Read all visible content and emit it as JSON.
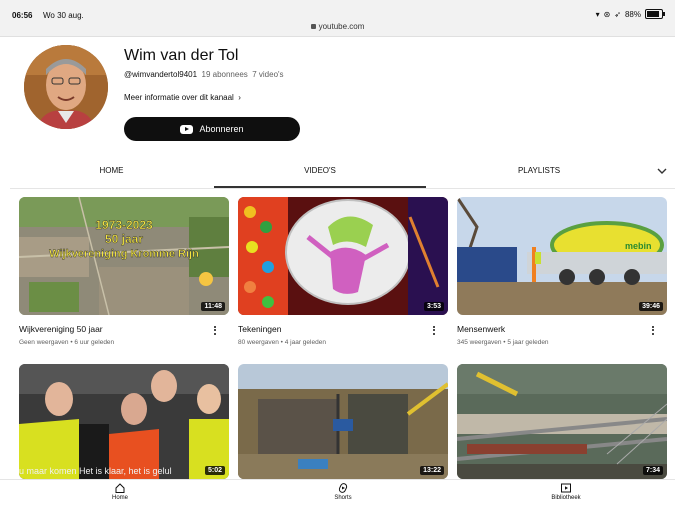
{
  "status_bar": {
    "time": "06:56",
    "date": "Wo 30 aug.",
    "url": "youtube.com",
    "battery": "88%"
  },
  "channel": {
    "name": "Wim van der Tol",
    "handle": "@wimvandertol9401",
    "subscribers": "19 abonnees",
    "video_count": "7 video's",
    "more_info": "Meer informatie over dit kanaal",
    "subscribe_label": "Abonneren"
  },
  "tabs": [
    {
      "label": "HOME"
    },
    {
      "label": "VIDEO'S"
    },
    {
      "label": "PLAYLISTS"
    }
  ],
  "videos": [
    {
      "title": "Wijkvereniging 50 jaar",
      "duration": "11:48",
      "views": "Geen weergaven",
      "age": "6 uur geleden",
      "overlay_text": "1973-2023 50 jaar Wijkvereniging Kromme Rijn"
    },
    {
      "title": "Tekeningen",
      "duration": "3:53",
      "views": "80 weergaven",
      "age": "4 jaar geleden"
    },
    {
      "title": "Mensenwerk",
      "duration": "39:46",
      "views": "345 weergaven",
      "age": "5 jaar geleden",
      "overlay_text": "mebin"
    },
    {
      "title": "",
      "duration": "5:02",
      "overlay_text": "u maar komen   Het is klaar, het is gelul"
    },
    {
      "title": "",
      "duration": "13:22"
    },
    {
      "title": "",
      "duration": "7:34"
    }
  ],
  "bottom_nav": [
    {
      "label": "Home",
      "icon": "home-icon"
    },
    {
      "label": "Shorts",
      "icon": "shorts-icon"
    },
    {
      "label": "Bibliotheek",
      "icon": "library-icon"
    }
  ]
}
